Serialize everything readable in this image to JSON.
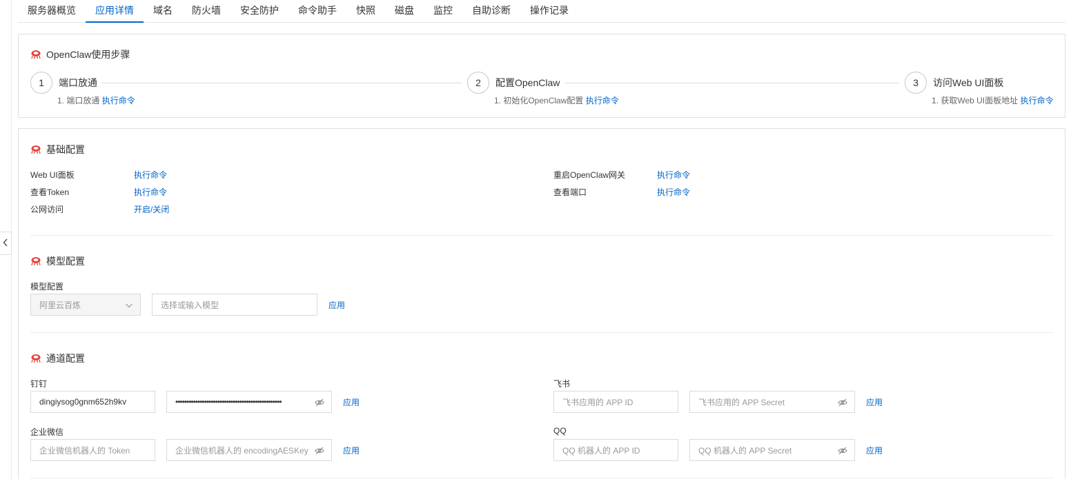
{
  "tabs": [
    {
      "label": "服务器概览",
      "active": false
    },
    {
      "label": "应用详情",
      "active": true
    },
    {
      "label": "域名",
      "active": false
    },
    {
      "label": "防火墙",
      "active": false
    },
    {
      "label": "安全防护",
      "active": false
    },
    {
      "label": "命令助手",
      "active": false
    },
    {
      "label": "快照",
      "active": false
    },
    {
      "label": "磁盘",
      "active": false
    },
    {
      "label": "监控",
      "active": false
    },
    {
      "label": "自助诊断",
      "active": false
    },
    {
      "label": "操作记录",
      "active": false
    }
  ],
  "steps_card": {
    "title": "OpenClaw使用步骤",
    "steps": [
      {
        "num": "1",
        "title": "端口放通",
        "desc": "1. 端口放通",
        "link": "执行命令"
      },
      {
        "num": "2",
        "title": "配置OpenClaw",
        "desc": "1. 初始化OpenClaw配置",
        "link": "执行命令"
      },
      {
        "num": "3",
        "title": "访问Web UI面板",
        "desc": "1. 获取Web UI面板地址",
        "link": "执行命令"
      }
    ]
  },
  "basic_config": {
    "title": "基础配置",
    "items": [
      {
        "label": "Web UI面板",
        "action": "执行命令"
      },
      {
        "label": "查看Token",
        "action": "执行命令"
      },
      {
        "label": "公网访问",
        "action": "开启/关闭"
      },
      {
        "label": "重启OpenClaw网关",
        "action": "执行命令"
      },
      {
        "label": "查看端口",
        "action": "执行命令"
      }
    ]
  },
  "model_config": {
    "title": "模型配置",
    "field_label": "模型配置",
    "provider_value": "阿里云百炼",
    "model_placeholder": "选择或输入模型",
    "apply": "应用"
  },
  "channel_config": {
    "title": "通道配置",
    "dingtalk": {
      "label": "钉钉",
      "app_key_value": "dingiysog0gnm652h9kv",
      "secret_masked": "••••••••••••••••••••••••••••••••••••••••••••••••",
      "apply": "应用"
    },
    "feishu": {
      "label": "飞书",
      "app_id_placeholder": "飞书应用的 APP ID",
      "secret_placeholder": "飞书应用的 APP Secret",
      "apply": "应用"
    },
    "wecom": {
      "label": "企业微信",
      "token_placeholder": "企业微信机器人的 Token",
      "aes_placeholder": "企业微信机器人的 encodingAESKey",
      "apply": "应用"
    },
    "qq": {
      "label": "QQ",
      "app_id_placeholder": "QQ 机器人的 APP ID",
      "secret_placeholder": "QQ 机器人的 APP Secret",
      "apply": "应用"
    }
  },
  "colors": {
    "accent": "#0064c8",
    "icon_red": "#e8413a"
  }
}
